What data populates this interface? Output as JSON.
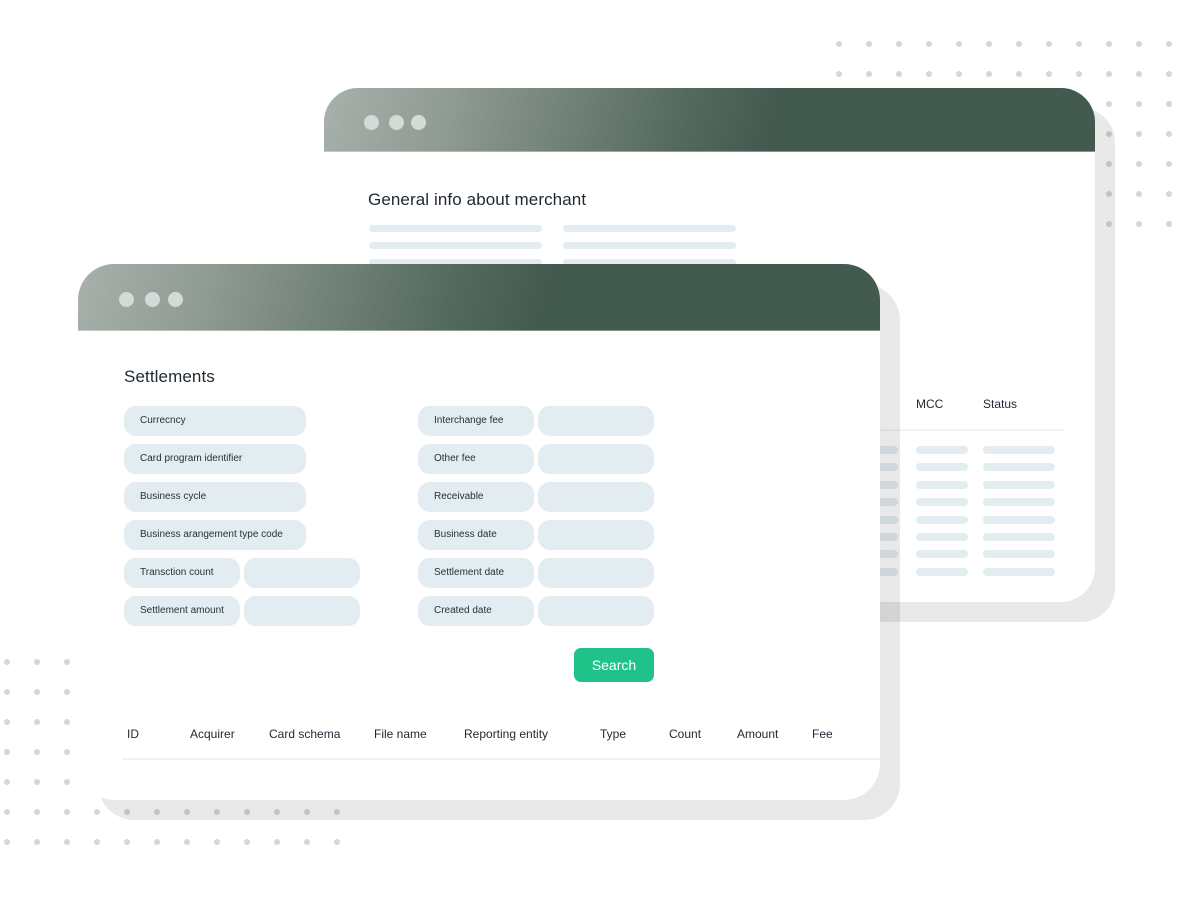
{
  "back_window": {
    "title": "General info about merchant",
    "table_headers": [
      "MCC",
      "Status"
    ],
    "info_placeholder_rows": 3,
    "table_placeholder_rows": 8
  },
  "front_window": {
    "title": "Settlements",
    "fields_left": [
      {
        "label": "Currecncy",
        "value": ""
      },
      {
        "label": "Card program identifier",
        "value": ""
      },
      {
        "label": "Business cycle",
        "value": ""
      },
      {
        "label": "Business arangement type code",
        "value": ""
      },
      {
        "label": "Transction count",
        "value": ""
      },
      {
        "label": "Settlement amount",
        "value": ""
      }
    ],
    "fields_right": [
      {
        "label": "Interchange fee",
        "value": ""
      },
      {
        "label": "Other fee",
        "value": ""
      },
      {
        "label": "Receivable",
        "value": ""
      },
      {
        "label": "Business date",
        "value": ""
      },
      {
        "label": "Settlement date",
        "value": ""
      },
      {
        "label": "Created date",
        "value": ""
      }
    ],
    "search_label": "Search",
    "table_headers": [
      "ID",
      "Acquirer",
      "Card schema",
      "File name",
      "Reporting entity",
      "Type",
      "Count",
      "Amount",
      "Fee"
    ]
  },
  "colors": {
    "titlebar_dark": "#435a4f",
    "titlebar_light": "#a8b1ab",
    "accent_button": "#1fc38a",
    "field_background": "#e3ecf0",
    "decor_dots": "#d3d6dc"
  }
}
